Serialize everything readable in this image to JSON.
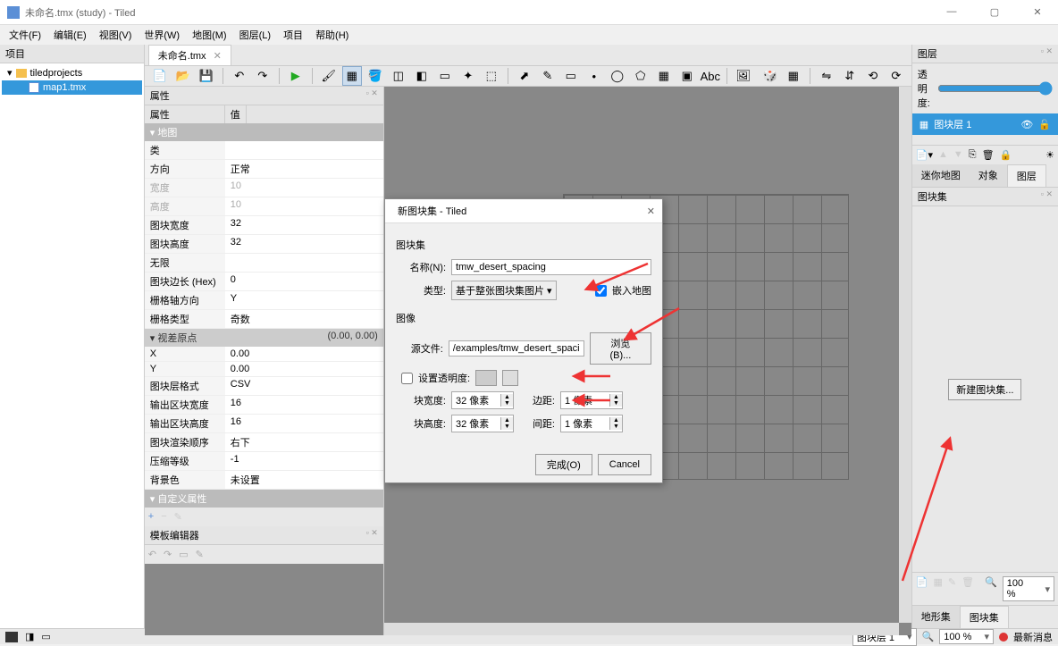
{
  "window": {
    "title": "未命名.tmx (study) - Tiled"
  },
  "menubar": [
    "文件(F)",
    "编辑(E)",
    "视图(V)",
    "世界(W)",
    "地图(M)",
    "图层(L)",
    "项目",
    "帮助(H)"
  ],
  "project": {
    "panel_title": "项目",
    "folder": "tiledprojects",
    "file": "map1.tmx"
  },
  "tabs": {
    "active": "未命名.tmx"
  },
  "properties": {
    "panel_title": "属性",
    "col_prop": "属性",
    "col_val": "值",
    "section_map": "地图",
    "rows": [
      {
        "k": "类",
        "v": ""
      },
      {
        "k": "方向",
        "v": "正常"
      },
      {
        "k": "宽度",
        "v": "10",
        "dim": true
      },
      {
        "k": "高度",
        "v": "10",
        "dim": true
      },
      {
        "k": "图块宽度",
        "v": "32"
      },
      {
        "k": "图块高度",
        "v": "32"
      },
      {
        "k": "无限",
        "v": ""
      },
      {
        "k": "图块边长 (Hex)",
        "v": "0"
      },
      {
        "k": "栅格轴方向",
        "v": "Y"
      },
      {
        "k": "栅格类型",
        "v": "奇数"
      }
    ],
    "parallax_section": "视差原点",
    "parallax_val": "(0.00, 0.00)",
    "parallax_rows": [
      {
        "k": "X",
        "v": "0.00"
      },
      {
        "k": "Y",
        "v": "0.00"
      }
    ],
    "rows2": [
      {
        "k": "图块层格式",
        "v": "CSV"
      },
      {
        "k": "输出区块宽度",
        "v": "16"
      },
      {
        "k": "输出区块高度",
        "v": "16"
      },
      {
        "k": "图块渲染顺序",
        "v": "右下"
      },
      {
        "k": "压缩等级",
        "v": "-1"
      },
      {
        "k": "背景色",
        "v": "未设置"
      }
    ],
    "section_custom": "自定义属性"
  },
  "template": {
    "panel_title": "模板编辑器"
  },
  "layers": {
    "panel_title": "图层",
    "opacity_label": "透明度:",
    "layer1": "图块层 1",
    "tabs": [
      "迷你地图",
      "对象",
      "图层"
    ],
    "tileset_panel": "图块集",
    "new_tileset_btn": "新建图块集...",
    "bottom_tabs": [
      "地形集",
      "图块集"
    ]
  },
  "dialog": {
    "title": "新图块集 - Tiled",
    "g_tileset": "图块集",
    "name_label": "名称(N):",
    "name_value": "tmw_desert_spacing",
    "type_label": "类型:",
    "type_value": "基于整张图块集图片",
    "embed_label": "嵌入地图",
    "g_image": "图像",
    "source_label": "源文件:",
    "source_value": "/examples/tmw_desert_spacing.png",
    "browse": "浏览(B)...",
    "trans_label": "设置透明度:",
    "tile_w_label": "块宽度:",
    "tile_w": "32 像素",
    "margin_label": "边距:",
    "margin": "1 像素",
    "tile_h_label": "块高度:",
    "tile_h": "32 像素",
    "spacing_label": "间距:",
    "spacing": "1 像素",
    "ok": "完成(O)",
    "cancel": "Cancel"
  },
  "statusbar": {
    "layer_sel": "图块层 1",
    "zoom": "100 %",
    "news": "最新消息",
    "zoom2": "100 %"
  }
}
